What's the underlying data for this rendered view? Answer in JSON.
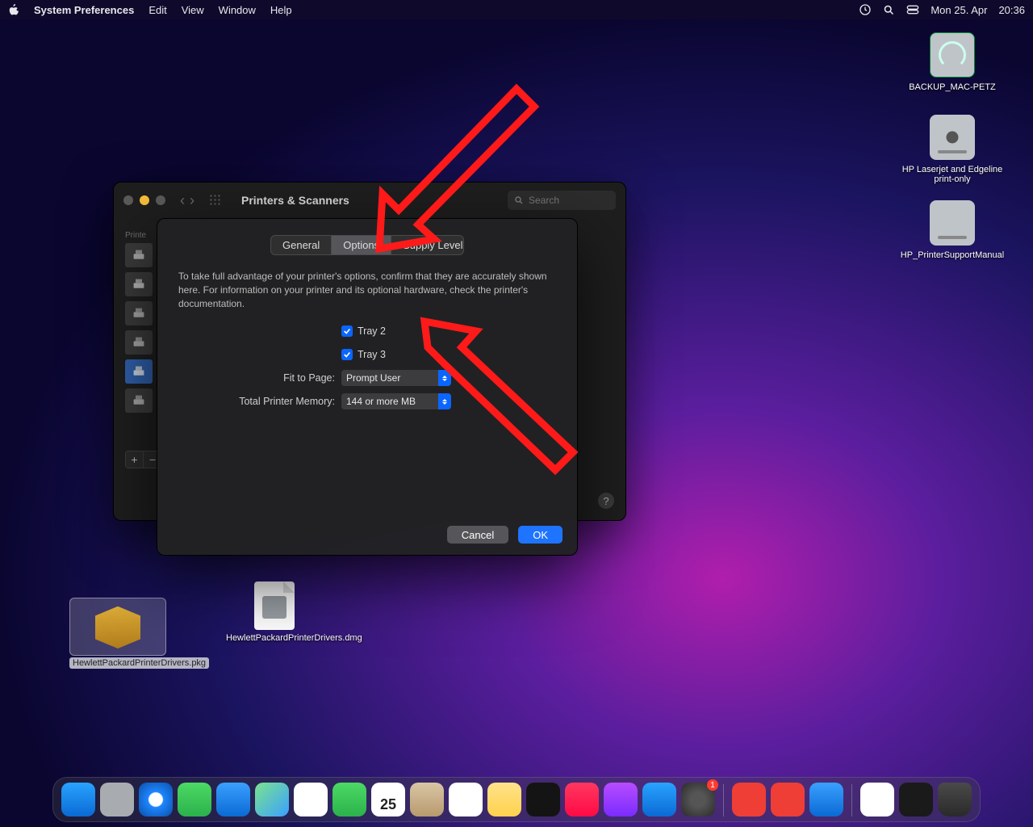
{
  "menubar": {
    "app": "System Preferences",
    "items": [
      "Edit",
      "View",
      "Window",
      "Help"
    ],
    "status": {
      "date": "Mon 25. Apr",
      "time": "20:36"
    }
  },
  "desktop": {
    "right": [
      {
        "name": "BACKUP_MAC-PETZ"
      },
      {
        "name": "HP Laserjet and Edgeline print-only"
      },
      {
        "name": "HP_PrinterSupportManual"
      }
    ],
    "bottom": [
      {
        "name": "HewlettPackardPrinterDrivers.pkg",
        "selected": true
      },
      {
        "name": "HewlettPackardPrinterDrivers.dmg",
        "selected": false
      }
    ]
  },
  "window": {
    "back_disabled": true,
    "title": "Printers & Scanners",
    "search_placeholder": "Search",
    "sidebar_header": "Printe",
    "plus": "+",
    "minus": "−"
  },
  "sheet": {
    "tabs": {
      "general": "General",
      "options": "Options",
      "supply": "Supply Levels"
    },
    "info": "To take full advantage of your printer's options, confirm that they are accurately shown here. For information on your printer and its optional hardware, check the printer's documentation.",
    "tray2": {
      "checked": true,
      "label": "Tray 2"
    },
    "tray3": {
      "checked": true,
      "label": "Tray 3"
    },
    "fit_label": "Fit to Page:",
    "fit_value": "Prompt User",
    "mem_label": "Total Printer Memory:",
    "mem_value": "144 or more MB",
    "cancel": "Cancel",
    "ok": "OK"
  },
  "dock": {
    "items": [
      {
        "name": "finder",
        "bg": "linear-gradient(#29a3ff,#0a6ad4)"
      },
      {
        "name": "launchpad",
        "bg": "linear-gradient(#ff6a6a,#ff9e3d,#5ad463,#2aa7ff)"
      },
      {
        "name": "safari",
        "bg": "radial-gradient(circle,#fff 30%,#1e86ff 33%,#0a4fa8 100%)"
      },
      {
        "name": "messages",
        "bg": "linear-gradient(#4cd964,#2bb24c)"
      },
      {
        "name": "mail",
        "bg": "linear-gradient(#3aa0ff,#0a6ad4)"
      },
      {
        "name": "maps",
        "bg": "linear-gradient(#7be38f,#3aa0ff)"
      },
      {
        "name": "photos",
        "bg": "conic-gradient(#ff5a5a,#ffcc33,#55d66a,#33aaff,#cc55ff,#ff5a5a)"
      },
      {
        "name": "facetime",
        "bg": "linear-gradient(#4cd964,#2bb24c)"
      },
      {
        "name": "calendar",
        "bg": "#fff",
        "text": "25",
        "badge": null
      },
      {
        "name": "contacts",
        "bg": "linear-gradient(#d9c6a5,#b89a6e)"
      },
      {
        "name": "reminders",
        "bg": "#fff"
      },
      {
        "name": "notes",
        "bg": "linear-gradient(#ffe28a,#ffd24d)"
      },
      {
        "name": "tv",
        "bg": "#141414"
      },
      {
        "name": "music",
        "bg": "linear-gradient(#ff3860,#ff0a44)"
      },
      {
        "name": "podcasts",
        "bg": "linear-gradient(#b84cff,#7a2cff)"
      },
      {
        "name": "appstore",
        "bg": "linear-gradient(#29a3ff,#0a6ad4)"
      },
      {
        "name": "settings",
        "bg": "radial-gradient(circle,#555 30%,#2a2a2a 100%)",
        "badge": "1"
      },
      {
        "name": "anydesk1",
        "bg": "#ef3e36"
      },
      {
        "name": "anydesk2",
        "bg": "#ef3e36"
      },
      {
        "name": "hp",
        "bg": "linear-gradient(#3aa0ff,#0a6ad4)"
      }
    ],
    "right": [
      {
        "name": "pages-doc",
        "bg": "#fff"
      },
      {
        "name": "kdoc",
        "bg": "#1a1a1a"
      },
      {
        "name": "trash",
        "bg": "linear-gradient(#4a4a4a,#2a2a2a)"
      }
    ]
  }
}
